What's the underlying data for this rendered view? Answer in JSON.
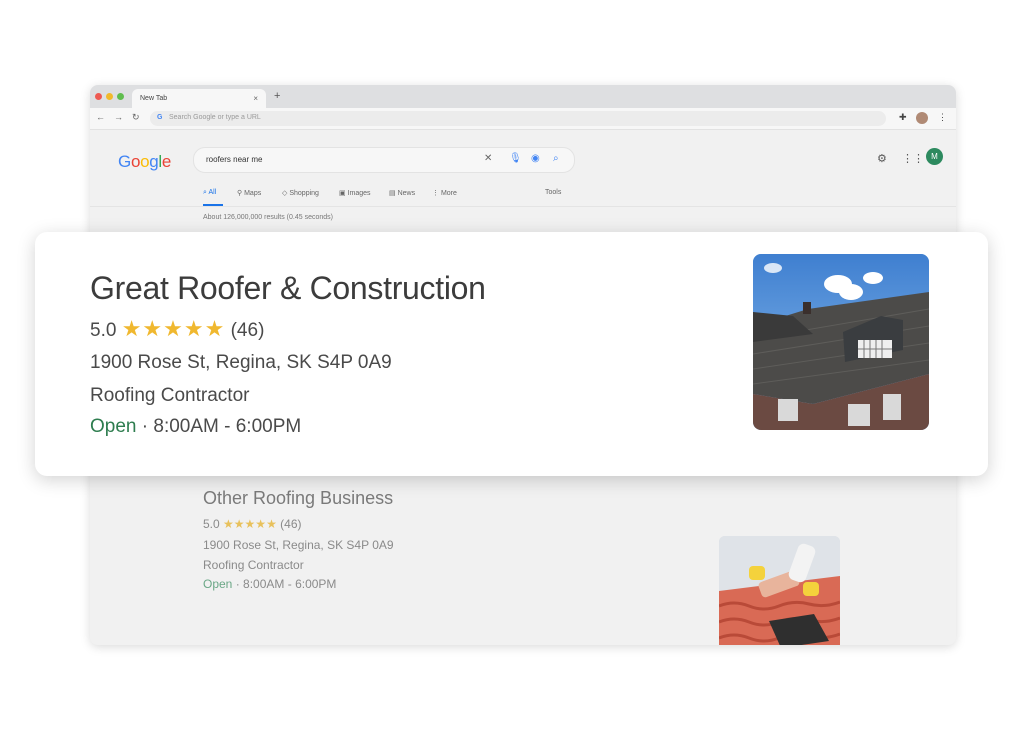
{
  "browser": {
    "tab_title": "New Tab",
    "tab_close": "×",
    "new_tab": "+",
    "address_placeholder": "Search Google or type a URL",
    "address_g": "G"
  },
  "google": {
    "logo": [
      "G",
      "o",
      "o",
      "g",
      "l",
      "e"
    ],
    "logo_colors": [
      "#4285f4",
      "#ea4335",
      "#fbbc05",
      "#4285f4",
      "#34a853",
      "#ea4335"
    ],
    "query": "roofers near me",
    "user_initial": "M",
    "tabs": [
      {
        "icon": "⌕",
        "label": "All"
      },
      {
        "icon": "⚲",
        "label": "Maps"
      },
      {
        "icon": "◇",
        "label": "Shopping"
      },
      {
        "icon": "▣",
        "label": "Images"
      },
      {
        "icon": "▤",
        "label": "News"
      },
      {
        "icon": "⋮",
        "label": "More"
      }
    ],
    "tools": "Tools",
    "stats": "About 126,000,000 results (0.45 seconds)"
  },
  "featured": {
    "name": "Great Roofer & Construction",
    "rating": "5.0",
    "stars": "★★★★★",
    "reviews": "(46)",
    "address": "1900 Rose St, Regina, SK S4P 0A9",
    "category": "Roofing Contractor",
    "status": "Open",
    "separator": "·",
    "hours": "8:00AM - 6:00PM"
  },
  "other": {
    "name": "Other Roofing Business",
    "rating": "5.0",
    "stars": "★★★★★",
    "reviews": "(46)",
    "address": "1900 Rose St, Regina, SK S4P 0A9",
    "category": "Roofing Contractor",
    "status": "Open",
    "separator": "·",
    "hours": "8:00AM - 6:00PM"
  },
  "colors": {
    "accent_blue": "#1a73e8",
    "star_gold": "#f0b82f",
    "open_green": "#2e7d4f",
    "avatar_green": "#2d8a5f"
  }
}
